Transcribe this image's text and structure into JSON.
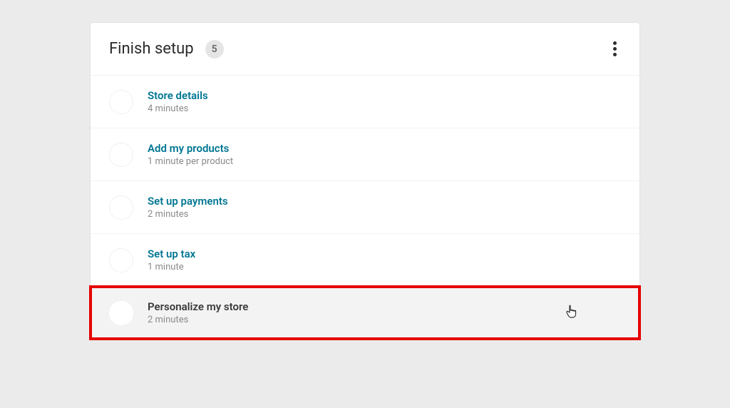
{
  "header": {
    "title": "Finish setup",
    "count": "5"
  },
  "tasks": [
    {
      "title": "Store details",
      "meta": "4 minutes",
      "active": false,
      "highlighted": false
    },
    {
      "title": "Add my products",
      "meta": "1 minute per product",
      "active": false,
      "highlighted": false
    },
    {
      "title": "Set up payments",
      "meta": "2 minutes",
      "active": false,
      "highlighted": false
    },
    {
      "title": "Set up tax",
      "meta": "1 minute",
      "active": false,
      "highlighted": false
    },
    {
      "title": "Personalize my store",
      "meta": "2 minutes",
      "active": true,
      "highlighted": true
    }
  ]
}
